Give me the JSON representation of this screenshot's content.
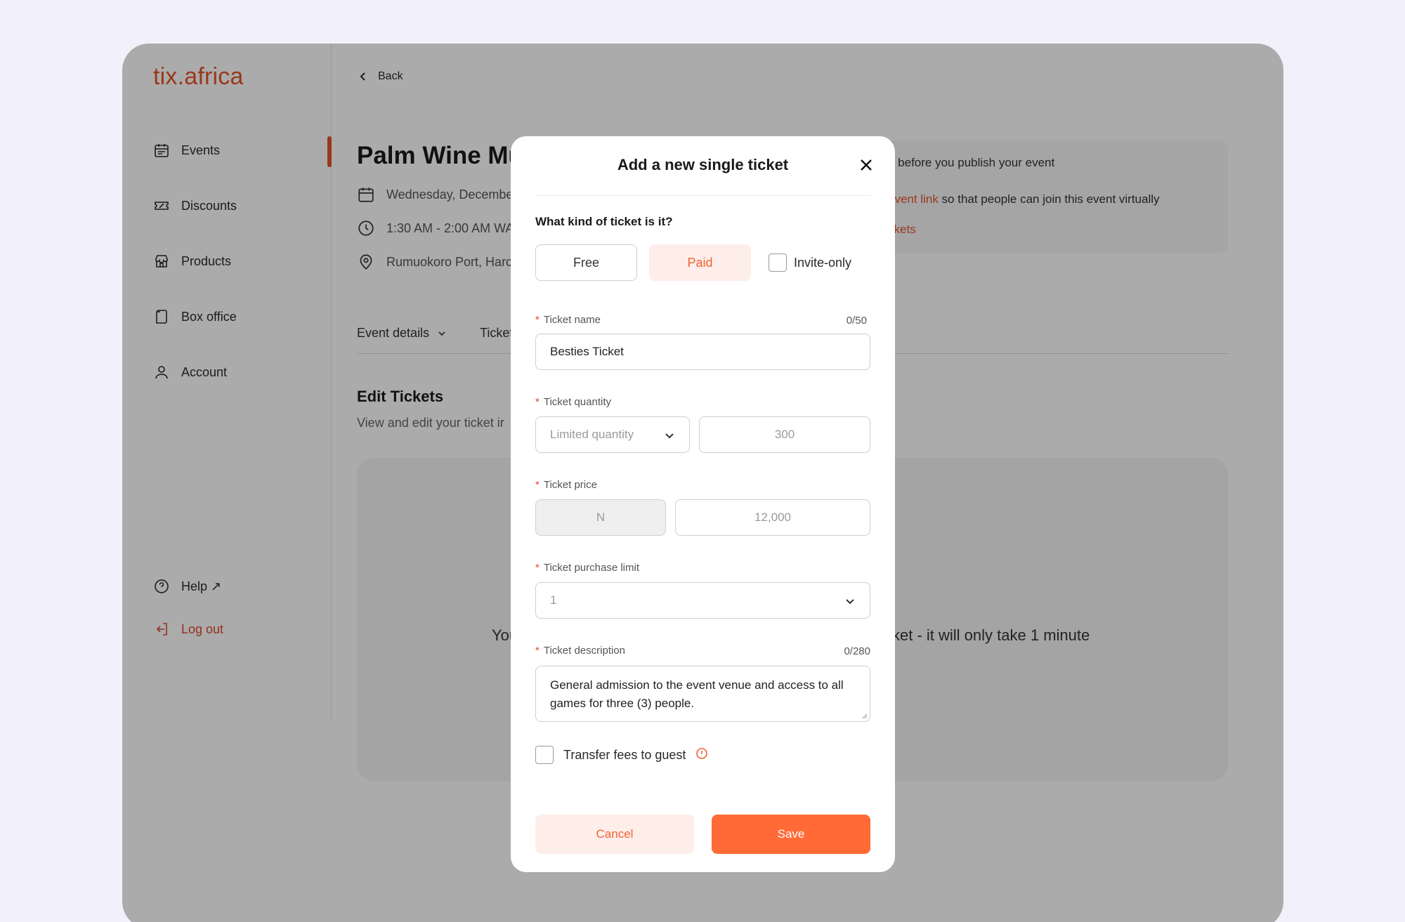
{
  "app": {
    "logo": "tix.africa"
  },
  "sidebar": {
    "items": [
      {
        "label": "Events",
        "icon": "calendar-icon"
      },
      {
        "label": "Discounts",
        "icon": "ticket-icon"
      },
      {
        "label": "Products",
        "icon": "store-icon"
      },
      {
        "label": "Box office",
        "icon": "file-icon"
      },
      {
        "label": "Account",
        "icon": "user-icon"
      }
    ],
    "help_label": "Help ↗",
    "logout_label": "Log out"
  },
  "main": {
    "back_label": "Back",
    "event_title": "Palm Wine Mu",
    "date_text": "Wednesday, Decembe",
    "time_text": "1:30 AM - 2:00 AM WA",
    "location_text": "Rumuokoro Port, Harc",
    "tabs": [
      {
        "label": "Event details"
      },
      {
        "label": "Ticket"
      }
    ],
    "section_title": "Edit Tickets",
    "section_subtitle": "View and edit your ticket ir",
    "empty_left": "You",
    "empty_right": "ket - it will only take 1 minute",
    "notice": {
      "line1": "o before you publish your event",
      "line2_link": "event link",
      "line2_rest": " so that people can join this event virtually",
      "line3_link": "ckets"
    }
  },
  "modal": {
    "title": "Add a new single ticket",
    "question": "What kind of ticket is it?",
    "type_free": "Free",
    "type_paid": "Paid",
    "invite_only": "Invite-only",
    "ticket_name": {
      "label": "Ticket name",
      "counter": "0/50",
      "value": "Besties Ticket"
    },
    "ticket_quantity": {
      "label": "Ticket quantity",
      "type_value": "Limited quantity",
      "amount_placeholder": "300"
    },
    "ticket_price": {
      "label": "Ticket price",
      "currency": "N",
      "amount_placeholder": "12,000"
    },
    "purchase_limit": {
      "label": "Ticket purchase limit",
      "value": "1"
    },
    "description": {
      "label": "Ticket description",
      "counter": "0/280",
      "value": "General admission to the event venue and access to all games for three (3) people."
    },
    "transfer_fees": "Transfer fees to guest",
    "cancel_label": "Cancel",
    "save_label": "Save"
  },
  "colors": {
    "accent": "#f16234",
    "accent_light": "#fdeee9",
    "save": "#ff6a36",
    "page_bg": "#f2f1fb"
  }
}
